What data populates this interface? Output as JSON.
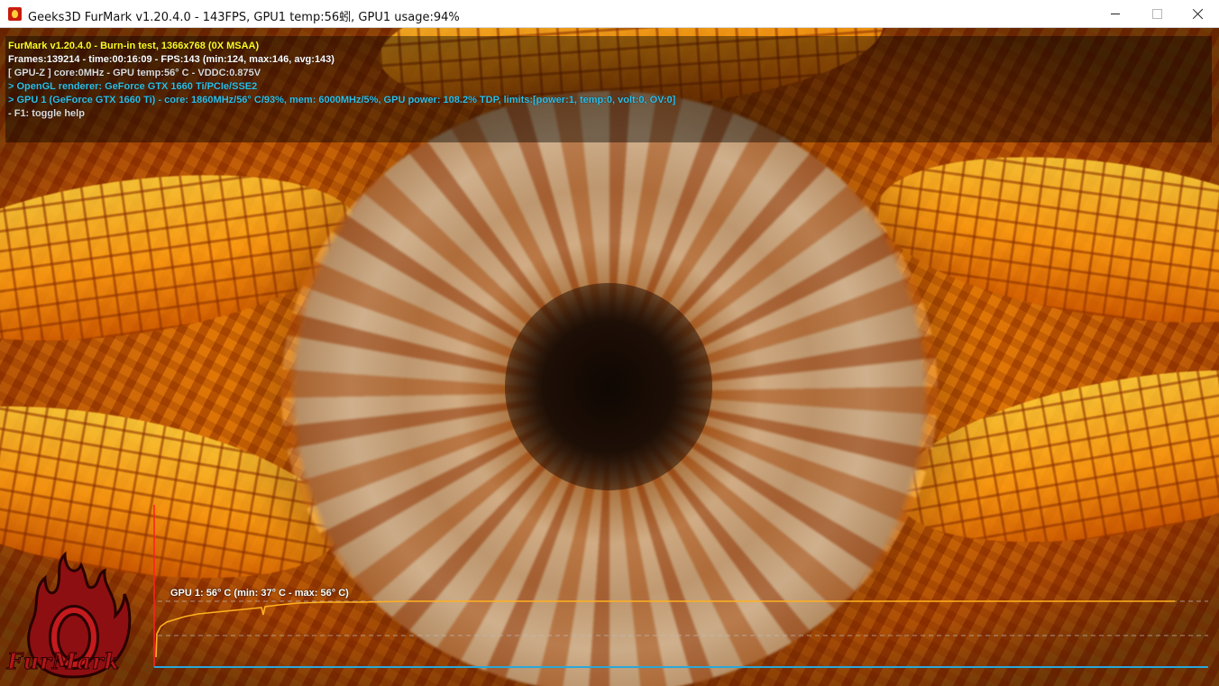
{
  "window": {
    "title": "Geeks3D FurMark v1.20.4.0 - 143FPS, GPU1 temp:56蚓, GPU1 usage:94%",
    "controls": [
      "minimize",
      "maximize",
      "close"
    ]
  },
  "osd": {
    "line1": "FurMark v1.20.4.0 - Burn-in test, 1366x768 (0X MSAA)",
    "line2": "Frames:139214 - time:00:16:09 - FPS:143 (min:124, max:146, avg:143)",
    "line3": "[ GPU-Z ] core:0MHz - GPU temp:56° C - VDDC:0.875V",
    "line4": "> OpenGL renderer: GeForce GTX 1660 Ti/PCIe/SSE2",
    "line5": "> GPU 1 (GeForce GTX 1660 Ti) - core: 1860MHz/56° C/93%, mem: 6000MHz/5%, GPU power: 108.2% TDP, limits:[power:1, temp:0, volt:0, OV:0]",
    "line6": "- F1: toggle help"
  },
  "logo": {
    "text": "FurMark"
  },
  "graph": {
    "label": "GPU 1: 56° C (min: 37° C - max: 56° C)",
    "current_c": 56,
    "min_c": 37,
    "max_c": 56
  },
  "colors": {
    "osd_title": "#ffff22",
    "osd_info": "#2fc0e8",
    "graph_line": "#ffb020",
    "graph_axis_x": "#2aa8d8",
    "graph_axis_y": "#ff2020",
    "close_hover": "#e81123"
  },
  "icons": {
    "app": "furmark-flame-icon",
    "minimize": "minimize-icon",
    "maximize": "maximize-icon",
    "close": "close-icon"
  }
}
